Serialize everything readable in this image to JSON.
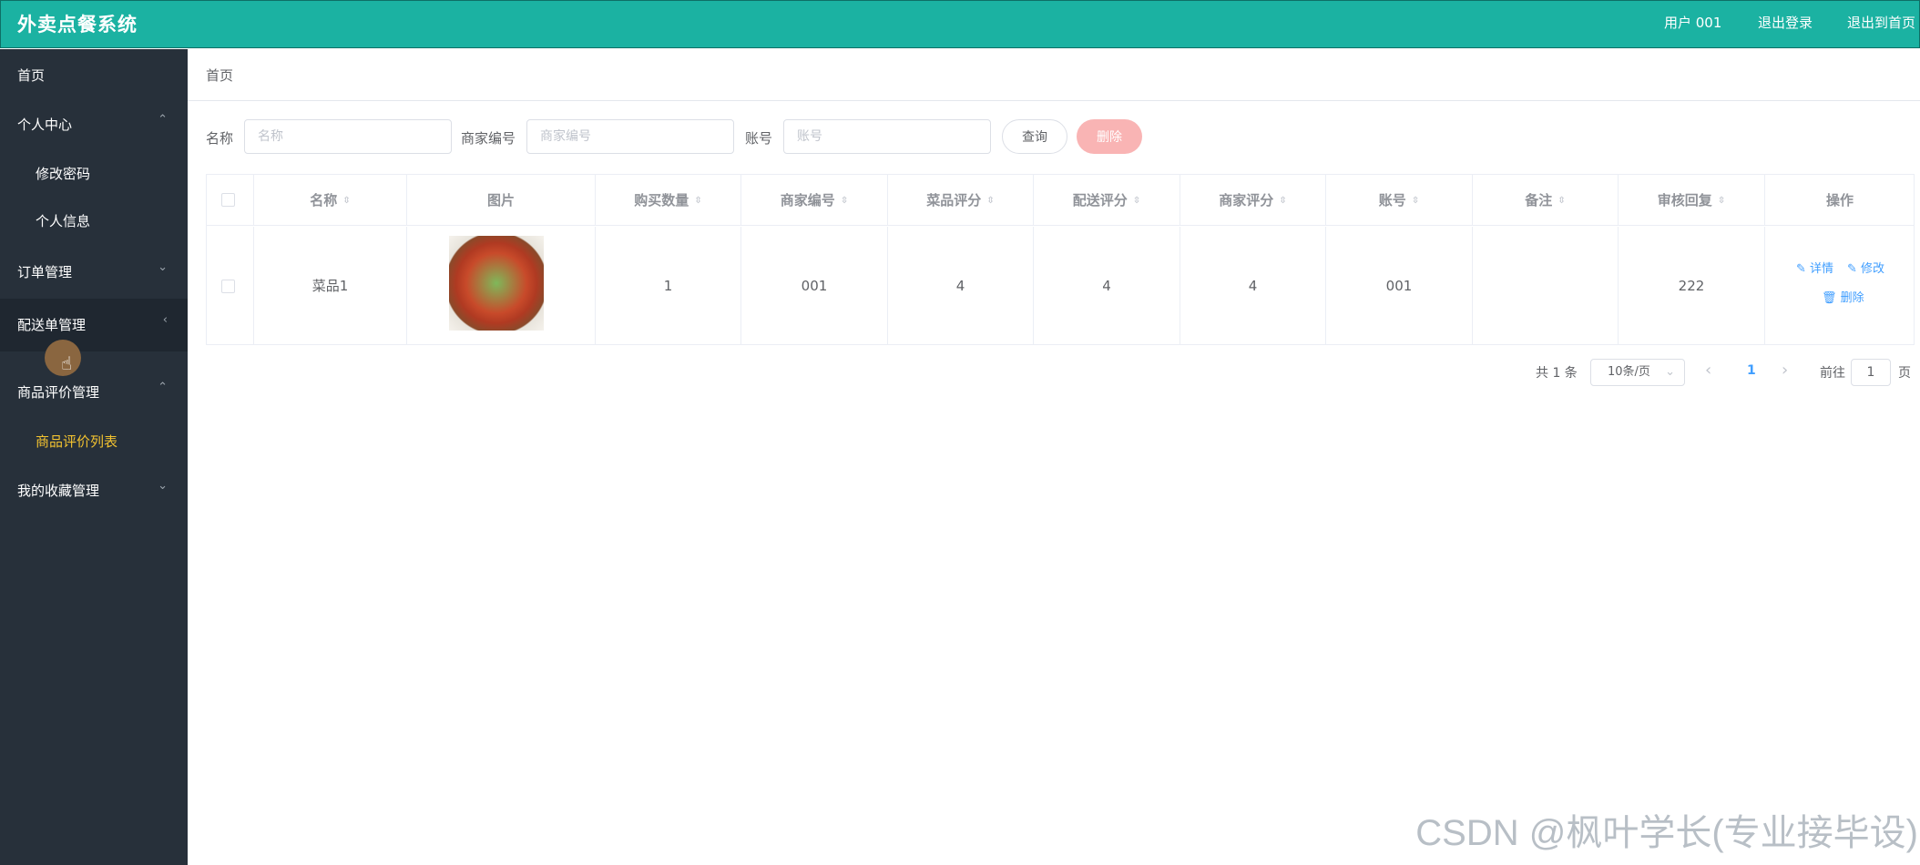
{
  "app": {
    "title": "外卖点餐系统"
  },
  "topbar": {
    "user": "用户 001",
    "logout": "退出登录",
    "exit_home": "退出到首页"
  },
  "sidebar": {
    "items": [
      {
        "label": "首页"
      },
      {
        "label": "个人中心",
        "arrow": "⌃"
      },
      {
        "label": "修改密码"
      },
      {
        "label": "个人信息"
      },
      {
        "label": "订单管理",
        "arrow": "⌄"
      },
      {
        "label": "配送单管理",
        "arrow": "‹"
      },
      {
        "label": "商品评价管理",
        "arrow": "⌃"
      },
      {
        "label": "商品评价列表"
      },
      {
        "label": "我的收藏管理",
        "arrow": "⌄"
      }
    ]
  },
  "breadcrumb": "首页",
  "search": {
    "name_label": "名称",
    "name_placeholder": "名称",
    "merchant_label": "商家编号",
    "merchant_placeholder": "商家编号",
    "account_label": "账号",
    "account_placeholder": "账号",
    "query_button": "查询",
    "delete_button": "删除"
  },
  "table": {
    "headers": [
      "名称",
      "图片",
      "购买数量",
      "商家编号",
      "菜品评分",
      "配送评分",
      "商家评分",
      "账号",
      "备注",
      "审核回复",
      "操作"
    ],
    "rows": [
      {
        "name": "菜品1",
        "quantity": "1",
        "merchant_no": "001",
        "dish_score": "4",
        "delivery_score": "4",
        "merchant_score": "4",
        "account": "001",
        "remark": "",
        "reply": "222",
        "actions": {
          "detail": "详情",
          "edit": "修改",
          "delete": "删除"
        }
      }
    ]
  },
  "pagination": {
    "total": "共 1 条",
    "page_size": "10条/页",
    "current_page": "1",
    "goto_label": "前往",
    "goto_value": "1",
    "page_suffix": "页",
    "prev": "‹",
    "next": "›"
  },
  "watermark": "CSDN @枫叶学长(专业接毕设)",
  "colors": {
    "header": "#1bb2a2",
    "sidebar": "#27303a",
    "active_menu": "#f2c230",
    "link": "#409eff",
    "delete_button": "#f9b4b4"
  }
}
